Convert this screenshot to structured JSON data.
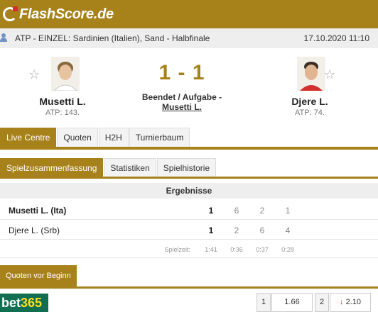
{
  "header": {
    "brand": "FlashScore.de"
  },
  "infobar": {
    "tournament": "ATP - EINZEL: Sardinien (Italien), Sand - Halbfinale",
    "datetime": "17.10.2020 11:10"
  },
  "match": {
    "home": {
      "name": "Musetti L.",
      "rank": "ATP: 143."
    },
    "away": {
      "name": "Djere L.",
      "rank": "ATP: 74."
    },
    "score": "1 - 1",
    "status_line1": "Beendet / Aufgabe -",
    "status_line2": "Musetti L."
  },
  "tabs_main": [
    "Live Centre",
    "Quoten",
    "H2H",
    "Turnierbaum"
  ],
  "tabs_sub": [
    "Spielzusammenfassung",
    "Statistiken",
    "Spielhistorie"
  ],
  "results": {
    "header": "Ergebnisse",
    "rows": [
      {
        "name": "Musetti L. (Ita)",
        "total": "1",
        "sets": [
          "6",
          "2",
          "1"
        ]
      },
      {
        "name": "Djere L. (Srb)",
        "total": "1",
        "sets": [
          "2",
          "6",
          "4"
        ]
      }
    ],
    "duration_label": "Spielzeit:",
    "durations": [
      "1:41",
      "0:36",
      "0:37",
      "0:28"
    ]
  },
  "odds": {
    "section_label": "Quoten vor Beginn",
    "bookmaker_a": "bet",
    "bookmaker_b": "365",
    "label1": "1",
    "value1": "1.66",
    "label2": "2",
    "value2": "2.10",
    "down_arrow": "↓"
  },
  "colors": {
    "accent": "#a7811a",
    "down": "#d2312e"
  }
}
